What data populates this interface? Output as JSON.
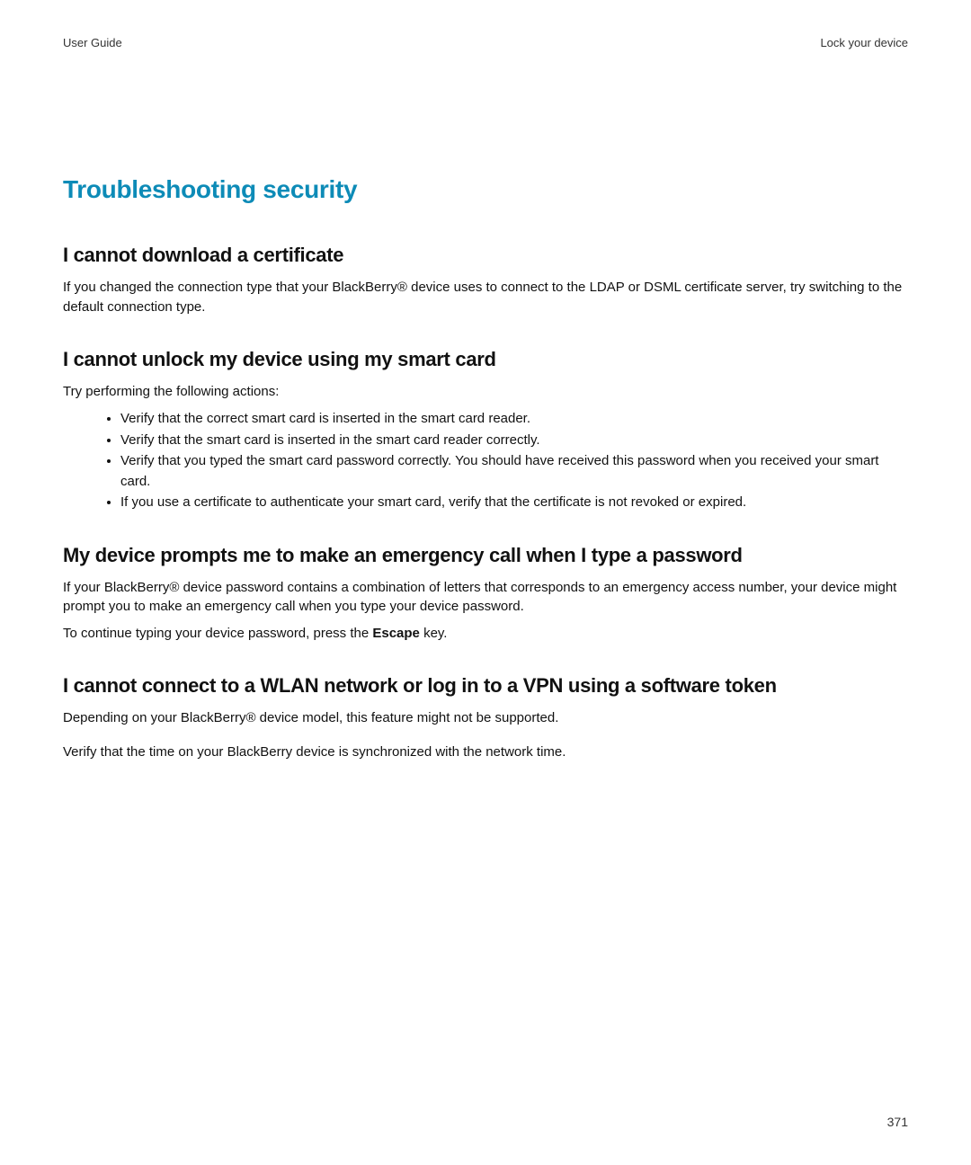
{
  "header": {
    "left": "User Guide",
    "right": "Lock your device"
  },
  "title": "Troubleshooting security",
  "sections": [
    {
      "heading": "I cannot download a certificate",
      "paragraphs": [
        "If you changed the connection type that your BlackBerry® device uses to connect to the LDAP or DSML certificate server, try switching to the default connection type."
      ]
    },
    {
      "heading": "I cannot unlock my device using my smart card",
      "intro": "Try performing the following actions:",
      "bullets": [
        "Verify that the correct smart card is inserted in the smart card reader.",
        "Verify that the smart card is inserted in the smart card reader correctly.",
        "Verify that you typed the smart card password correctly. You should have received this password when you received your smart card.",
        "If you use a certificate to authenticate your smart card, verify that the certificate is not revoked or expired."
      ]
    },
    {
      "heading": "My device prompts me to make an emergency call when I type a password",
      "paragraphs": [
        "If your BlackBerry® device password contains a combination of letters that corresponds to an emergency access number, your device might prompt you to make an emergency call when you type your device password."
      ],
      "escape_pre": "To continue typing your device password, press the ",
      "escape_key": "Escape",
      "escape_post": " key."
    },
    {
      "heading": "I cannot connect to a WLAN network or log in to a VPN using a software token",
      "paragraphs": [
        "Depending on your BlackBerry® device model, this feature might not be supported.",
        "Verify that the time on your BlackBerry device is synchronized with the network time."
      ]
    }
  ],
  "page_number": "371"
}
